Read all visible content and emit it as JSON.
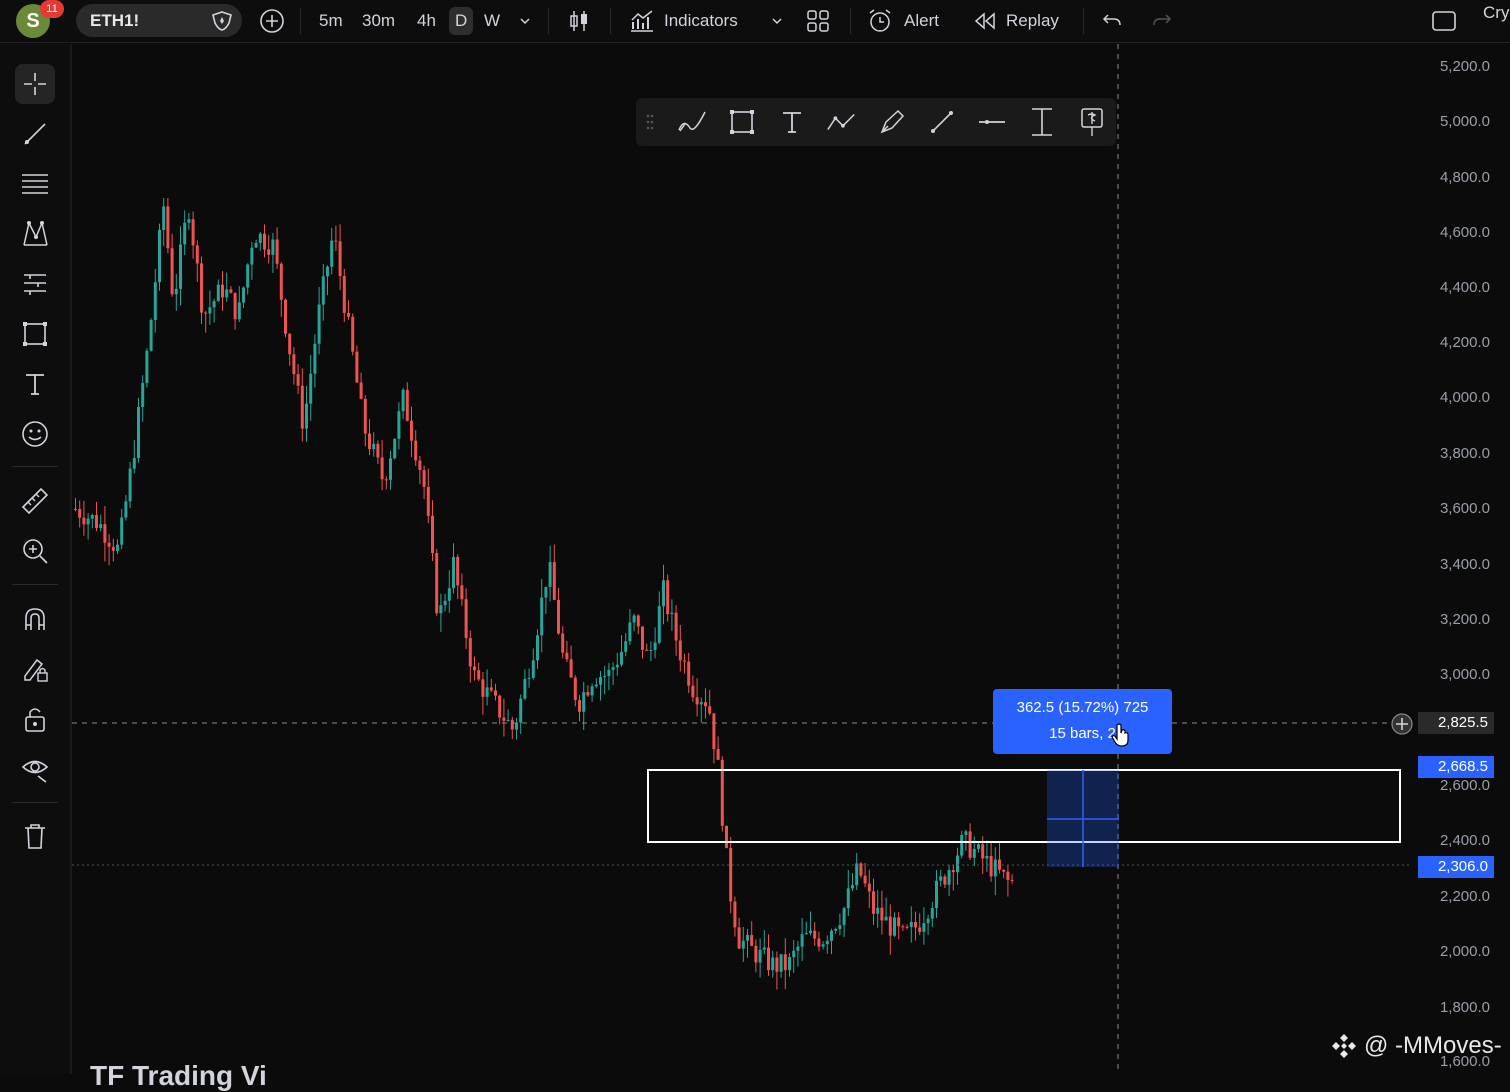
{
  "header": {
    "avatar_letter": "S",
    "notification_count": "11",
    "symbol": "ETH1!",
    "timeframes": [
      "5m",
      "30m",
      "4h",
      "D",
      "W"
    ],
    "active_timeframe": "D",
    "indicators_label": "Indicators",
    "alert_label": "Alert",
    "replay_label": "Replay",
    "right_cut_text": "Cry"
  },
  "left_toolbar": [
    "crosshair-icon",
    "trendline-icon",
    "fib-lines-icon",
    "pattern-icon",
    "forecast-icon",
    "rectangle-icon",
    "text-icon",
    "emoji-icon",
    "ruler-icon",
    "zoom-in-icon",
    "magnet-icon",
    "lock-drawing-icon",
    "unlock-icon",
    "eye-icon",
    "trash-icon"
  ],
  "drawing_toolbar": [
    "brush-icon",
    "rectangle-icon",
    "text-icon",
    "path-icon",
    "pen-icon",
    "line-icon",
    "horizontal-line-icon",
    "price-range-icon",
    "price-label-icon"
  ],
  "price_axis": {
    "ticks": [
      "5,200.0",
      "5,000.0",
      "4,800.0",
      "4,600.0",
      "4,400.0",
      "4,200.0",
      "4,000.0",
      "3,800.0",
      "3,600.0",
      "3,400.0",
      "3,200.0",
      "3,000.0",
      "2,600.0",
      "2,400.0",
      "2,200.0",
      "2,000.0",
      "1,800.0",
      "1,600.0"
    ],
    "crosshair_price": "2,825.5",
    "range_top_label": "2,668.5",
    "range_bottom_label": "2,306.0"
  },
  "measure_tooltip": {
    "line1": "362.5 (15.72%) 725",
    "line2": "15 bars, 2"
  },
  "watermark": "@ -MMoves-",
  "footer_cut_text": "TF Trading Vi",
  "colors": {
    "up": "#26a69a",
    "down": "#ef5350",
    "accent": "#2962ff",
    "background": "#0b0b0b"
  }
}
